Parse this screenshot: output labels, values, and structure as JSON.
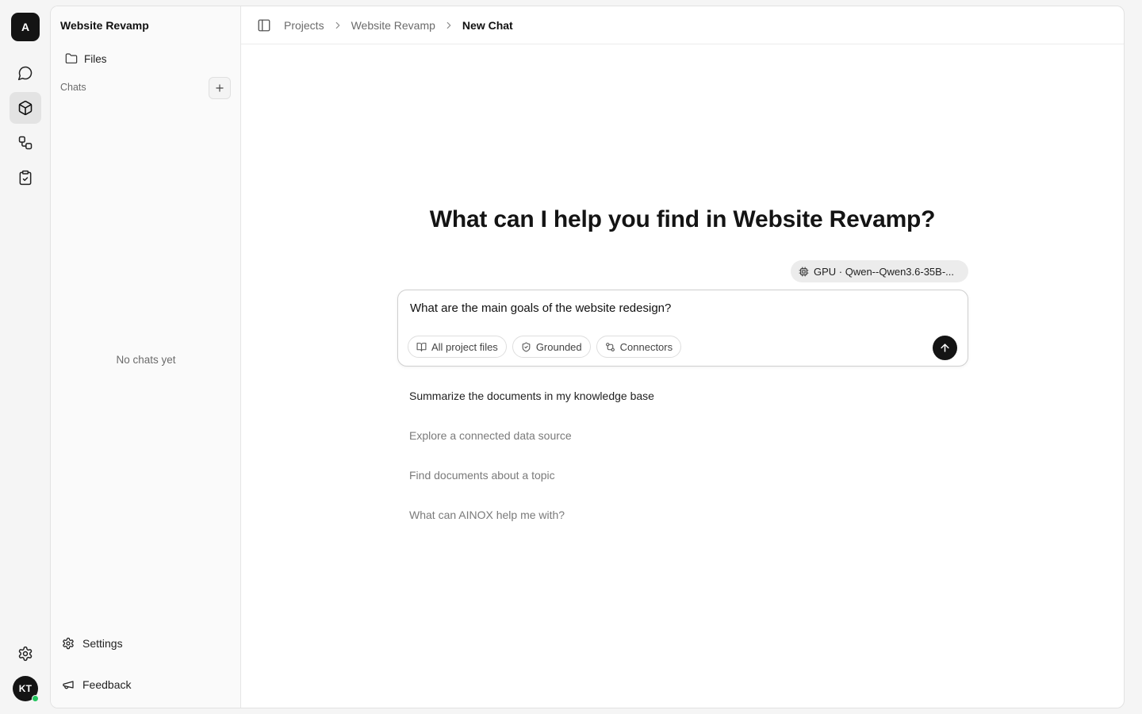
{
  "rail": {
    "logo": "A",
    "avatar_initials": "KT",
    "items": [
      "chat-icon",
      "box-icon",
      "workflow-icon",
      "clipboard-check-icon"
    ],
    "active_item": "box-icon"
  },
  "sidebar": {
    "project_title": "Website Revamp",
    "files_label": "Files",
    "chats_label": "Chats",
    "empty_chats": "No chats yet",
    "settings_label": "Settings",
    "feedback_label": "Feedback"
  },
  "breadcrumb": {
    "items": [
      "Projects",
      "Website Revamp",
      "New Chat"
    ]
  },
  "main": {
    "heading": "What can I help you find in Website Revamp?",
    "model_label": "GPU · Qwen--Qwen3.6-35B-...",
    "composer": {
      "value": "What are the main goals of the website redesign?",
      "chips": [
        "All project files",
        "Grounded",
        "Connectors"
      ]
    },
    "suggestions": [
      "Summarize the documents in my knowledge base",
      "Explore a connected data source",
      "Find documents about a topic",
      "What can AINOX help me with?"
    ]
  },
  "colors": {
    "accent_dark": "#141414",
    "online_status": "#22c55e",
    "muted_text": "#6b6b6b"
  }
}
